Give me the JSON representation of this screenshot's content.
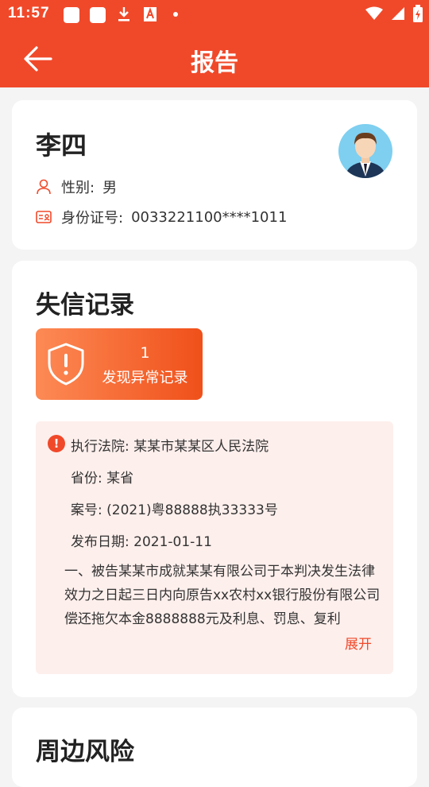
{
  "status_bar": {
    "time": "11:57"
  },
  "app_bar": {
    "title": "报告",
    "back_icon": "arrow-left-icon"
  },
  "profile": {
    "name": "李四",
    "gender_label": "性别:",
    "gender_value": "男",
    "id_label": "身份证号:",
    "id_value": "0033221100****1011"
  },
  "credit": {
    "title": "失信记录",
    "count": "1",
    "count_label": "发现异常记录",
    "record": {
      "court_label": "执行法院:",
      "court_value": "某某市某某区人民法院",
      "province_label": "省份:",
      "province_value": "某省",
      "case_label": "案号:",
      "case_value": "(2021)粤88888执33333号",
      "date_label": "发布日期:",
      "date_value": "2021-01-11",
      "detail": "一、被告某某市成就某某有限公司于本判决发生法律效力之日起三日内向原告xx农村xx银行股份有限公司偿还拖欠本金8888888元及利息、罚息、复利",
      "expand": "展开"
    }
  },
  "risk": {
    "title": "周边风险"
  },
  "colors": {
    "primary": "#f0492a",
    "record_bg": "#fdefec"
  }
}
